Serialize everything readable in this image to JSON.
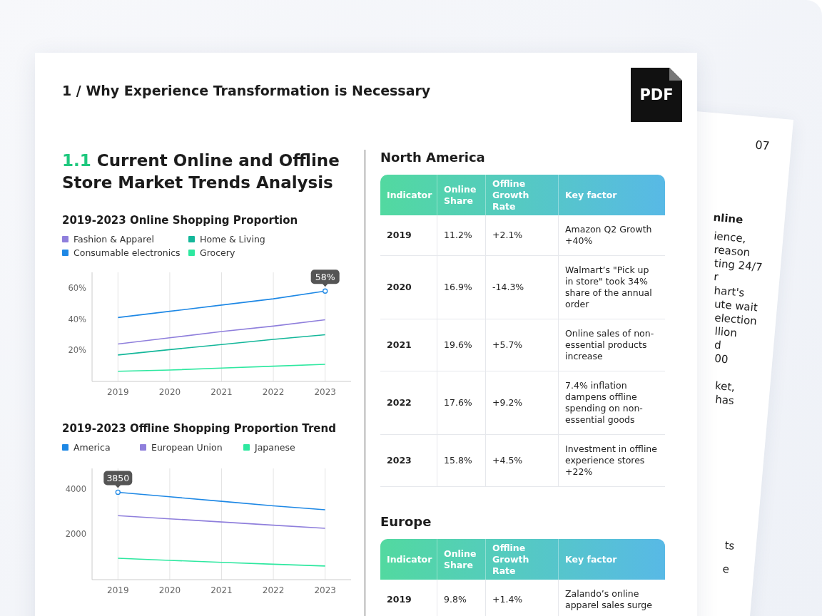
{
  "back_page": {
    "page_number": "07",
    "heading": "nline",
    "paragraphs": [
      [
        "ience,",
        "reason",
        "ting 24/7",
        "r",
        "hart's",
        "ute wait",
        "election",
        "llion",
        "d",
        "00"
      ],
      [
        "ket,",
        "has"
      ]
    ],
    "footer_lines": [
      "ts",
      "e"
    ]
  },
  "document": {
    "title": "1 / Why Experience Transformation is Necessary",
    "file_badge": "PDF",
    "section": {
      "number": "1.1",
      "title": "Current Online and Offline Store Market Trends Analysis"
    },
    "charts": [
      {
        "chart_data": {
          "type": "line",
          "title": "2019-2023 Online Shopping Proportion",
          "categories": [
            "2019",
            "2020",
            "2021",
            "2022",
            "2023"
          ],
          "grid": true,
          "ylim": [
            0,
            70
          ],
          "yticks": [
            {
              "value": 20,
              "label": "20%"
            },
            {
              "value": 40,
              "label": "40%"
            },
            {
              "value": 60,
              "label": "60%"
            }
          ],
          "series": [
            {
              "name": "Fashion & Apparel",
              "color": "#8f7fdc",
              "values": [
                24,
                28,
                32,
                35.5,
                39.6
              ]
            },
            {
              "name": "Consumable electronics",
              "color": "#1e88e5",
              "values": [
                41,
                45,
                49,
                53,
                58
              ]
            },
            {
              "name": "Home & Living",
              "color": "#14b79a",
              "values": [
                17,
                20.4,
                23.7,
                27,
                30
              ]
            },
            {
              "name": "Grocery",
              "color": "#2ee8a0",
              "values": [
                6.5,
                7.3,
                8.6,
                9.8,
                11
              ]
            }
          ],
          "annotations": [
            {
              "x": "2023",
              "y": 58,
              "text": "58%"
            }
          ]
        }
      },
      {
        "chart_data": {
          "type": "line",
          "title": "2019-2023 Offline Shopping Proportion Trend",
          "categories": [
            "2019",
            "2020",
            "2021",
            "2022",
            "2023"
          ],
          "grid": true,
          "ylim": [
            0,
            4900
          ],
          "yticks": [
            2000,
            4000
          ],
          "series": [
            {
              "name": "America",
              "color": "#1e88e5",
              "values": [
                3850,
                3650,
                3450,
                3250,
                3080
              ]
            },
            {
              "name": "European Union",
              "color": "#8f7fdc",
              "values": [
                2820,
                2680,
                2540,
                2400,
                2260
              ]
            },
            {
              "name": "Japanese",
              "color": "#2ee8a0",
              "values": [
                940,
                850,
                760,
                680,
                600
              ]
            }
          ],
          "annotations": [
            {
              "x": "2019",
              "y": 3850,
              "text": "3850"
            }
          ]
        }
      }
    ],
    "tables": [
      {
        "region": "North America",
        "columns": [
          "Indicator",
          "Online Share",
          "Offline Growth Rate",
          "Key factor"
        ],
        "rows": [
          [
            "2019",
            "11.2%",
            "+2.1%",
            "Amazon Q2 Growth +40%"
          ],
          [
            "2020",
            "16.9%",
            "-14.3%",
            "Walmart’s \"Pick up in store\" took 34% share of the annual order"
          ],
          [
            "2021",
            "19.6%",
            "+5.7%",
            "Online sales of non-essential products increase"
          ],
          [
            "2022",
            "17.6%",
            "+9.2%",
            "7.4% inflation dampens offline spending on non-essential goods"
          ],
          [
            "2023",
            "15.8%",
            "+4.5%",
            "Investment in offline experience stores +22%"
          ]
        ]
      },
      {
        "region": "Europe",
        "columns": [
          "Indicator",
          "Online Share",
          "Offline Growth Rate",
          "Key factor"
        ],
        "rows": [
          [
            "2019",
            "9.8%",
            "+1.4%",
            "Zalando’s online apparel sales surge"
          ]
        ]
      }
    ]
  }
}
